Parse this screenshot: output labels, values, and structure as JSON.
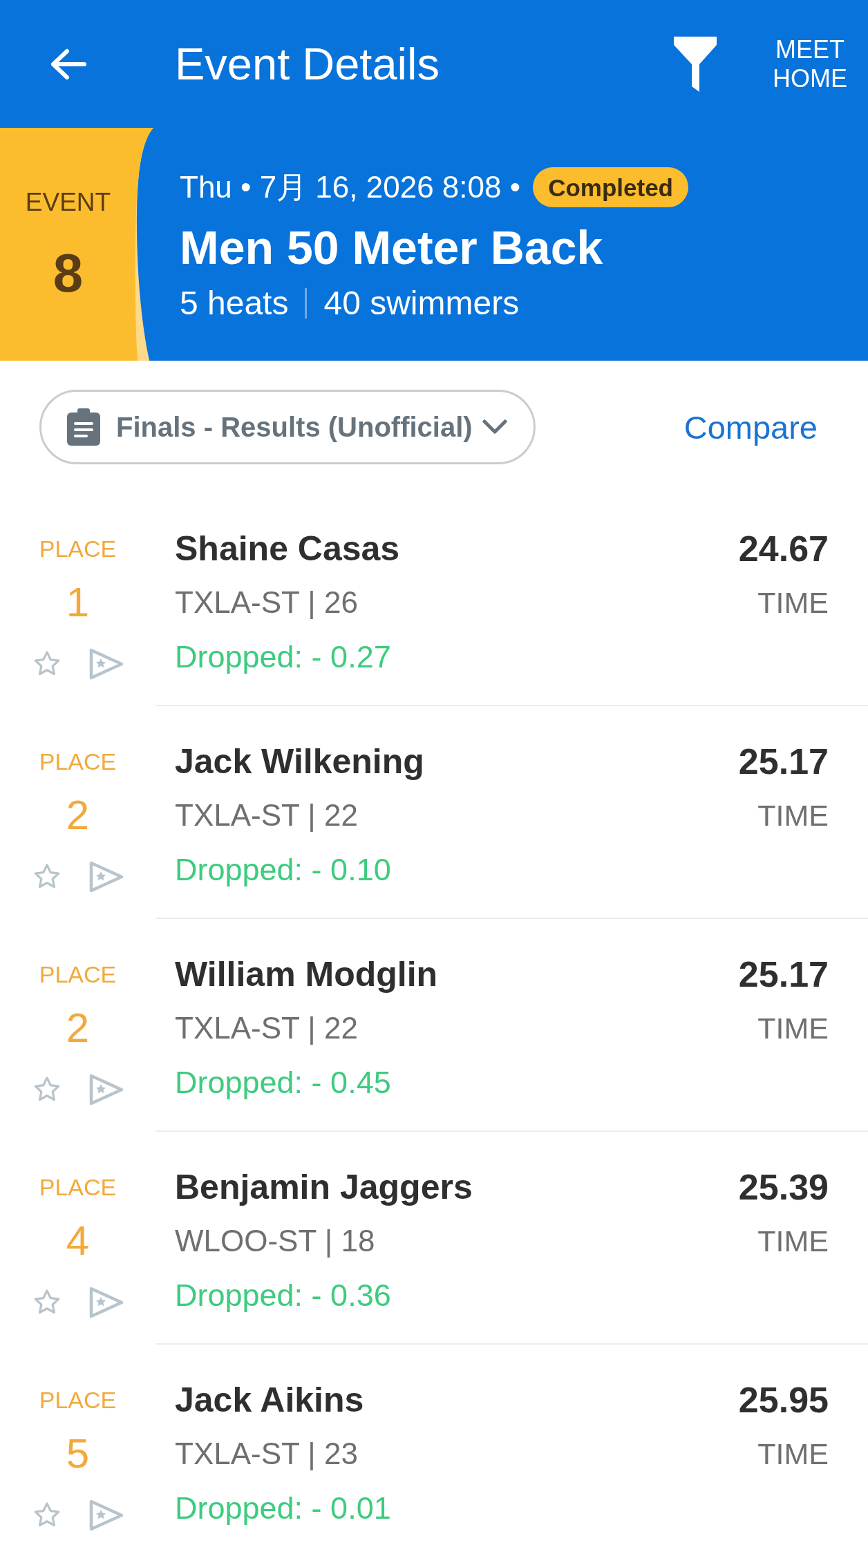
{
  "header": {
    "title": "Event Details",
    "action": "MEET HOME"
  },
  "event": {
    "label": "EVENT",
    "number": "8",
    "date_line": "Thu • 7月 16, 2026 8:08 •",
    "status": "Completed",
    "name": "Men 50 Meter Back",
    "heats": "5 heats",
    "swimmers": "40 swimmers"
  },
  "results_selector": {
    "value": "Finals - Results (Unofficial)"
  },
  "compare_link": "Compare",
  "results": [
    {
      "place_label": "PLACE",
      "place": "1",
      "name": "Shaine Casas",
      "team_age": "TXLA-ST | 26",
      "time": "24.67",
      "time_label": "TIME",
      "change": "Dropped: - 0.27"
    },
    {
      "place_label": "PLACE",
      "place": "2",
      "name": "Jack Wilkening",
      "team_age": "TXLA-ST | 22",
      "time": "25.17",
      "time_label": "TIME",
      "change": "Dropped: - 0.10"
    },
    {
      "place_label": "PLACE",
      "place": "2",
      "name": "William Modglin",
      "team_age": "TXLA-ST | 22",
      "time": "25.17",
      "time_label": "TIME",
      "change": "Dropped: - 0.45"
    },
    {
      "place_label": "PLACE",
      "place": "4",
      "name": "Benjamin Jaggers",
      "team_age": "WLOO-ST | 18",
      "time": "25.39",
      "time_label": "TIME",
      "change": "Dropped: - 0.36"
    },
    {
      "place_label": "PLACE",
      "place": "5",
      "name": "Jack Aikins",
      "team_age": "TXLA-ST | 23",
      "time": "25.95",
      "time_label": "TIME",
      "change": "Dropped: - 0.01"
    }
  ]
}
